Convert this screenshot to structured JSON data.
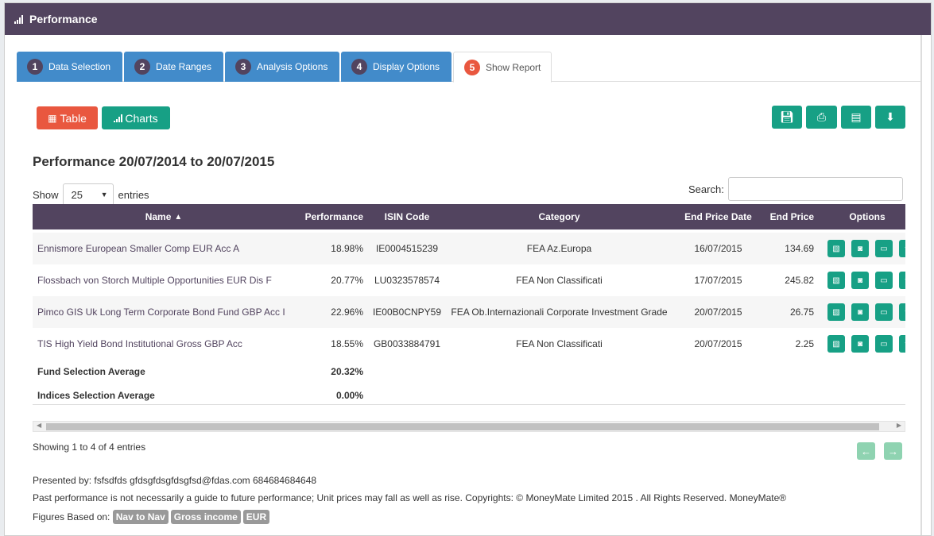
{
  "header": {
    "title": "Performance",
    "icon": "signal-bars-icon"
  },
  "tabs": [
    {
      "num": "1",
      "label": "Data Selection"
    },
    {
      "num": "2",
      "label": "Date Ranges"
    },
    {
      "num": "3",
      "label": "Analysis Options"
    },
    {
      "num": "4",
      "label": "Display Options"
    },
    {
      "num": "5",
      "label": "Show Report",
      "active": true
    }
  ],
  "view": {
    "table_label": "Table",
    "charts_label": "Charts"
  },
  "toolbar_icons": [
    "save-icon",
    "print-icon",
    "pdf-icon",
    "download-icon"
  ],
  "report": {
    "title": "Performance 20/07/2014 to 20/07/2015"
  },
  "length": {
    "show": "Show",
    "value": "25",
    "entries": "entries"
  },
  "search": {
    "label": "Search:",
    "value": ""
  },
  "table": {
    "columns": [
      "Name",
      "Performance",
      "ISIN Code",
      "Category",
      "End Price Date",
      "End Price",
      "Options"
    ],
    "rows": [
      {
        "name": "Ennismore European Smaller Comp EUR Acc A",
        "perf": "18.98%",
        "isin": "IE0004515239",
        "cat": "FEA Az.Europa",
        "date": "16/07/2015",
        "price": "134.69"
      },
      {
        "name": "Flossbach von Storch Multiple Opportunities EUR Dis F",
        "perf": "20.77%",
        "isin": "LU0323578574",
        "cat": "FEA Non Classificati",
        "date": "17/07/2015",
        "price": "245.82"
      },
      {
        "name": "Pimco GIS Uk Long Term Corporate Bond Fund GBP Acc I",
        "perf": "22.96%",
        "isin": "IE00B0CNPY59",
        "cat": "FEA Ob.Internazionali Corporate Investment Grade",
        "date": "20/07/2015",
        "price": "26.75"
      },
      {
        "name": "TIS High Yield Bond Institutional Gross GBP Acc",
        "perf": "18.55%",
        "isin": "GB0033884791",
        "cat": "FEA Non Classificati",
        "date": "20/07/2015",
        "price": "2.25"
      }
    ],
    "averages": [
      {
        "label": "Fund Selection Average",
        "value": "20.32%"
      },
      {
        "label": "Indices Selection Average",
        "value": "0.00%"
      }
    ]
  },
  "info": "Showing 1 to 4 of 4 entries",
  "footer": {
    "presented": "Presented by: fsfsdfds gfdsgfdsgfdsgfsd@fdas.com 684684684648",
    "disclaimer": "Past performance is not necessarily a guide to future performance; Unit prices may fall as well as rise. Copyrights: © MoneyMate Limited 2015 . All Rights Reserved. MoneyMate®",
    "figures_label": "Figures Based on:",
    "labels": [
      "Nav to Nav",
      "Gross income",
      "EUR"
    ]
  },
  "colors": {
    "header": "#52445f",
    "tab": "#428bca",
    "active_badge": "#e9573f",
    "green": "#17a085",
    "red": "#e9573f"
  }
}
